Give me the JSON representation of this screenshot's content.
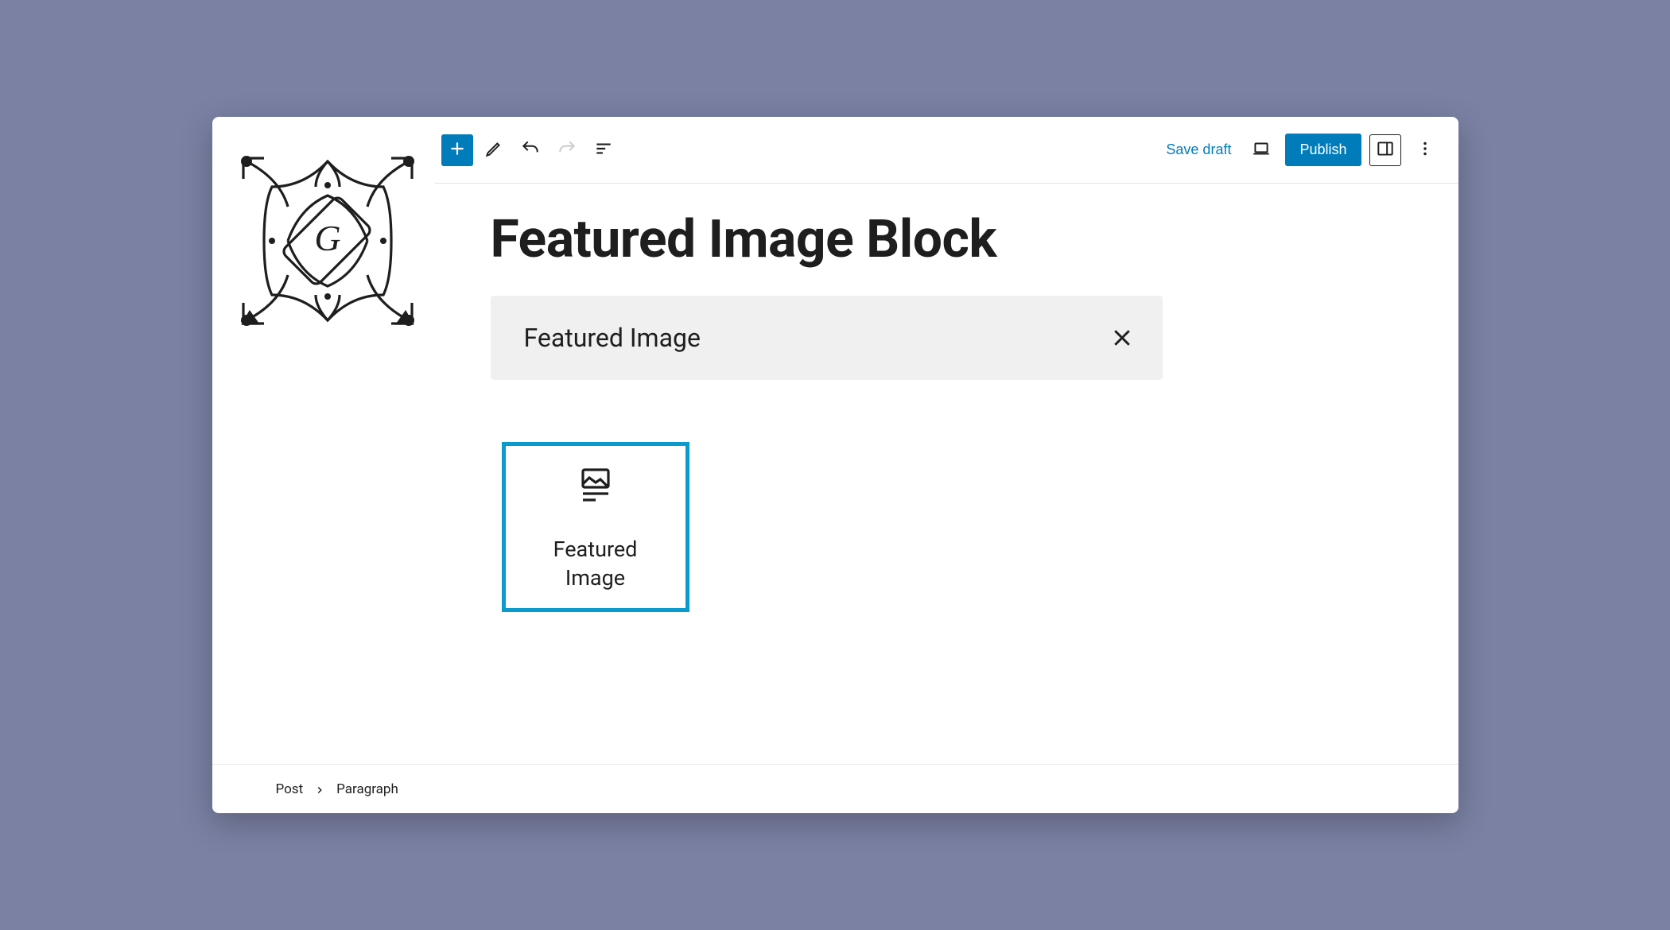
{
  "toolbar": {
    "save_draft_label": "Save draft",
    "publish_label": "Publish"
  },
  "post": {
    "title": "Featured Image Block"
  },
  "search": {
    "query": "Featured Image"
  },
  "block_result": {
    "label": "Featured Image"
  },
  "breadcrumb": {
    "root": "Post",
    "current": "Paragraph"
  }
}
